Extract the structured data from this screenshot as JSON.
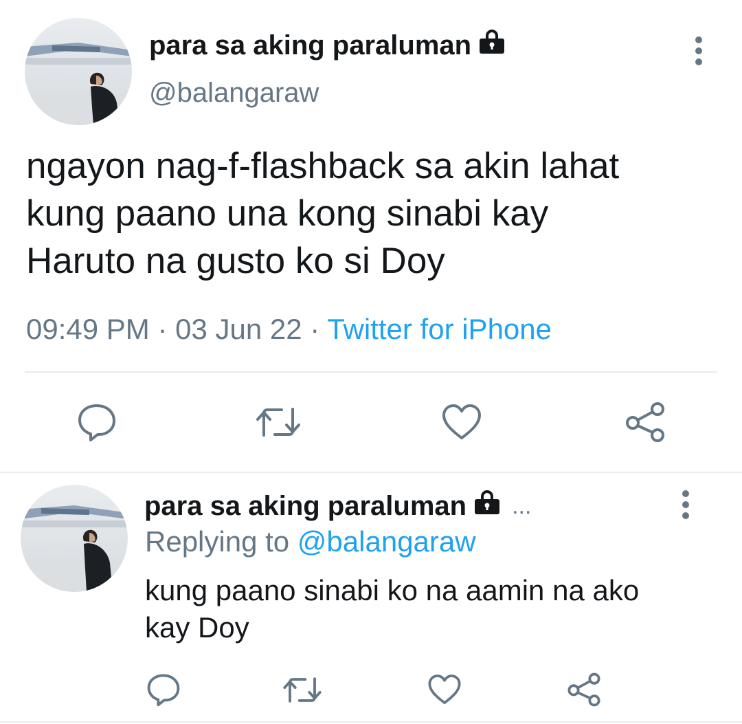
{
  "main_tweet": {
    "display_name": "para sa aking paraluman",
    "handle": "@balangaraw",
    "text_lines": [
      "ngayon nag-f-flashback sa akin lahat",
      "kung paano una kong sinabi kay",
      "Haruto na gusto ko si Doy"
    ],
    "time": "09:49 PM",
    "separator1": " · ",
    "date": "03 Jun 22",
    "separator2": " · ",
    "source": "Twitter for iPhone",
    "actions": [
      "reply-icon",
      "retweet-icon",
      "like-icon",
      "share-icon"
    ]
  },
  "reply_tweet": {
    "display_name": "para sa aking paraluman",
    "truncation": "...",
    "replying_prefix": "Replying to ",
    "replying_handle": "@balangaraw",
    "text_lines": [
      "kung paano sinabi ko na aamin na ako",
      "kay Doy"
    ],
    "actions": [
      "reply-icon",
      "retweet-icon",
      "like-icon",
      "share-icon"
    ]
  },
  "icons": {
    "lock": "lock-icon",
    "more": "vertical-dots-icon"
  },
  "colors": {
    "text": "#14171a",
    "secondary": "#657786",
    "link": "#1da1f2",
    "divider": "#e6ecf0",
    "icon": "#657786"
  }
}
